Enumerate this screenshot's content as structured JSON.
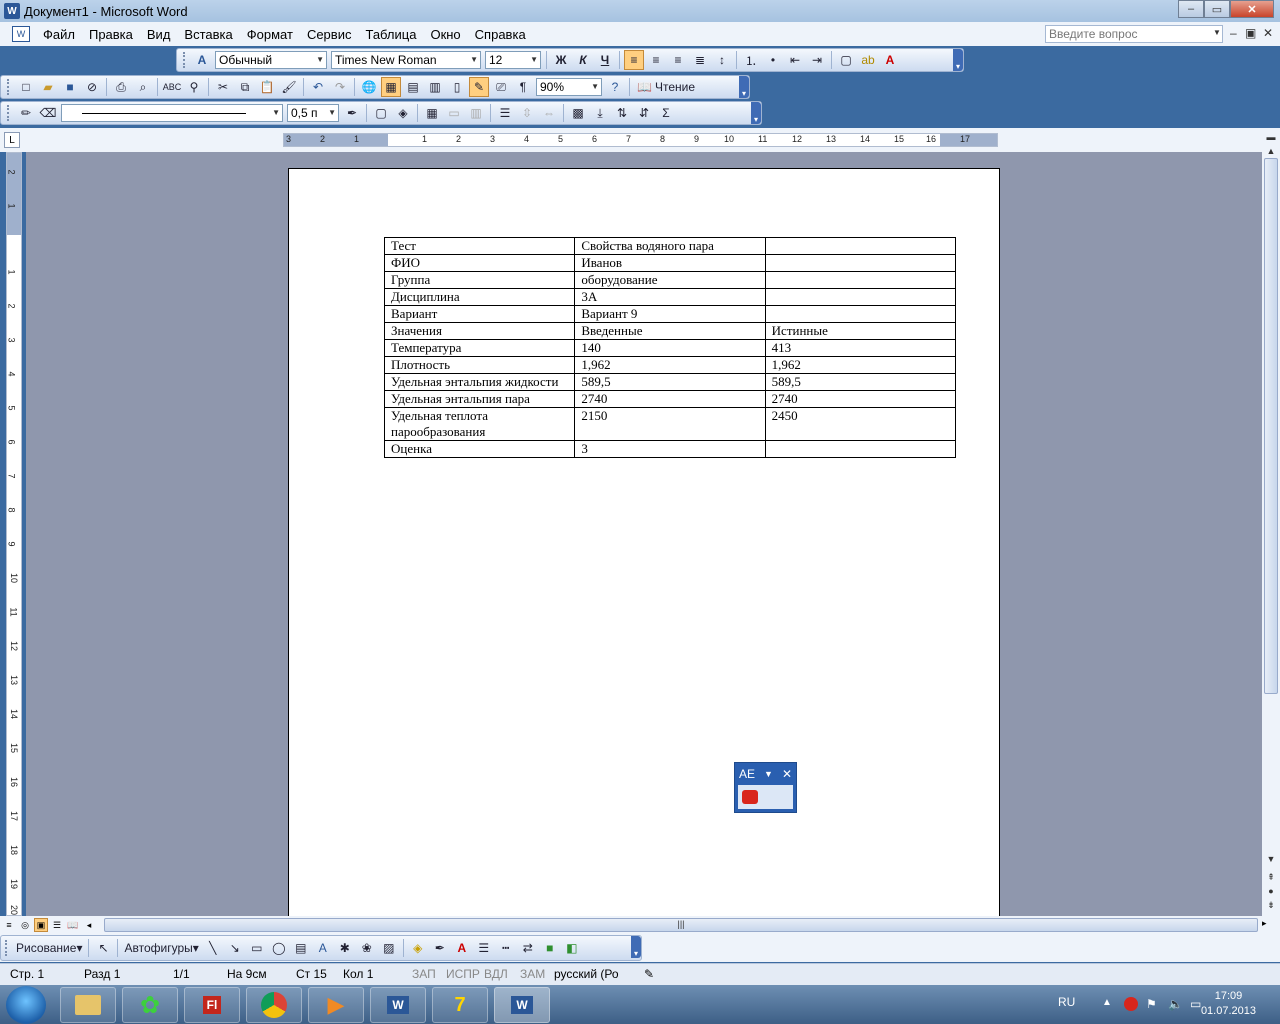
{
  "window": {
    "title": "Документ1 - Microsoft Word"
  },
  "menu": {
    "items": [
      "Файл",
      "Правка",
      "Вид",
      "Вставка",
      "Формат",
      "Сервис",
      "Таблица",
      "Окно",
      "Справка"
    ],
    "ask_placeholder": "Введите вопрос"
  },
  "formatting": {
    "style": "Обычный",
    "font": "Times New Roman",
    "size": "12",
    "bold": "Ж",
    "italic": "К",
    "underline": "Ч"
  },
  "standard": {
    "zoom": "90%",
    "reading": "Чтение",
    "pilcrow": "¶"
  },
  "tables_borders": {
    "line_weight": "0,5 п"
  },
  "ruler": {
    "h_numbers": [
      "3",
      "2",
      "1",
      "1",
      "2",
      "3",
      "4",
      "5",
      "6",
      "7",
      "8",
      "9",
      "10",
      "11",
      "12",
      "13",
      "14",
      "15",
      "16",
      "17"
    ],
    "v_numbers": [
      "2",
      "1",
      "1",
      "2",
      "3",
      "4",
      "5",
      "6",
      "7",
      "8",
      "9",
      "10",
      "11",
      "12",
      "13",
      "14",
      "15",
      "16",
      "17",
      "18",
      "19",
      "20"
    ]
  },
  "table": {
    "rows": [
      [
        "Тест",
        "Свойства водяного пара",
        ""
      ],
      [
        "ФИО",
        "Иванов",
        ""
      ],
      [
        "Группа",
        "оборудование",
        ""
      ],
      [
        "Дисциплина",
        "3А",
        ""
      ],
      [
        "Вариант",
        "Вариант 9",
        ""
      ],
      [
        "Значения",
        "Введенные",
        "Истинные"
      ],
      [
        "Температура",
        "140",
        "413"
      ],
      [
        "Плотность",
        "1,962",
        "1,962"
      ],
      [
        "Удельная энтальпия жидкости",
        "589,5",
        "589,5"
      ],
      [
        "Удельная энтальпия пара",
        "2740",
        "2740"
      ],
      [
        "Удельная теплота парообразования",
        "2150",
        "2450"
      ],
      [
        "Оценка",
        "3",
        ""
      ]
    ]
  },
  "floater": {
    "label": "АЕ"
  },
  "drawing": {
    "draw_label": "Рисование",
    "autoshapes_label": "Автофигуры"
  },
  "status": {
    "page": "Стр. 1",
    "section": "Разд 1",
    "pages": "1/1",
    "at": "На 9см",
    "line": "Ст 15",
    "col": "Кол 1",
    "rec": "ЗАП",
    "trk": "ИСПР",
    "ext": "ВДЛ",
    "ovr": "ЗАМ",
    "language": "русский (Ро"
  },
  "taskbar": {
    "lang": "RU",
    "time": "17:09",
    "date": "01.07.2013"
  },
  "colors": {
    "accent": "#ffcf80",
    "titlebar": "#bcd2ea",
    "docbg": "#8f97ad",
    "taskbar": "#3d5f86"
  }
}
